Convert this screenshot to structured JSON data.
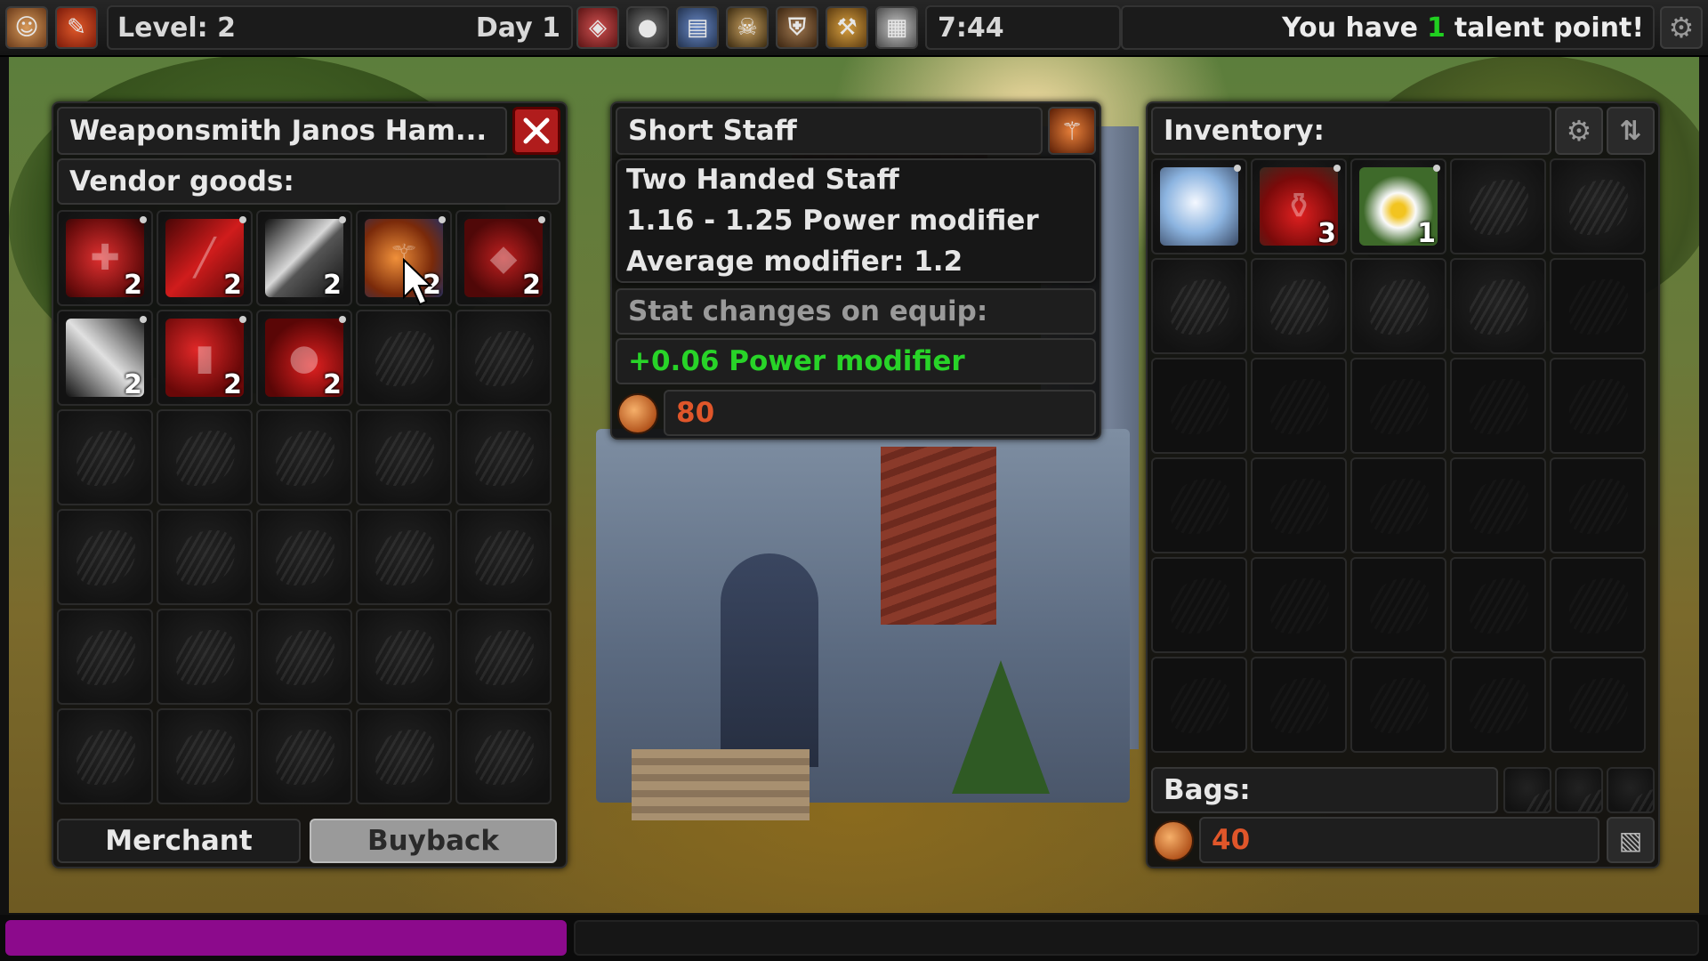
{
  "hud": {
    "level_label": "Level: 2",
    "day_label": "Day 1",
    "time": "7:44",
    "talent_prefix": "You have",
    "talent_points": "1",
    "talent_suffix": "talent point!",
    "xp_progress": 0.335,
    "menu_icons": [
      "portrait-icon",
      "quill-icon",
      "backpack-icon",
      "ore-icon",
      "spellbook-icon",
      "skull-flag-icon",
      "armor-icon",
      "crafting-icon",
      "scroll-icon"
    ],
    "settings_icon": "gear-icon"
  },
  "vendor": {
    "title": "Weaponsmith Janos Ham...",
    "section_label": "Vendor goods:",
    "items": [
      {
        "icon": "red-mace-icon",
        "count": "2"
      },
      {
        "icon": "red-staff-icon",
        "count": "2"
      },
      {
        "icon": "steel-sword-icon",
        "count": "2"
      },
      {
        "icon": "short-staff-icon",
        "count": "2"
      },
      {
        "icon": "red-axe-icon",
        "count": "2"
      },
      {
        "icon": "dagger-icon",
        "count": "2"
      },
      {
        "icon": "red-hammer-icon",
        "count": "2"
      },
      {
        "icon": "red-club-icon",
        "count": "2"
      }
    ],
    "tab_merchant": "Merchant",
    "tab_buyback": "Buyback"
  },
  "tooltip": {
    "item_name": "Short Staff",
    "item_type": "Two Handed Staff",
    "modifier_range": "1.16 - 1.25 Power modifier",
    "average_modifier": "Average modifier: 1.2",
    "stat_changes_label": "Stat changes on equip:",
    "stat_change": "+0.06 Power modifier",
    "price": "80",
    "colors": {
      "stat_positive": "#28d428",
      "price": "#e0562a"
    }
  },
  "inventory": {
    "title": "Inventory:",
    "items": [
      {
        "icon": "silver-orb-icon",
        "count": ""
      },
      {
        "icon": "health-potion-icon",
        "count": "3"
      },
      {
        "icon": "daisy-flower-icon",
        "count": "1"
      }
    ],
    "bags_label": "Bags:",
    "gold": "40"
  }
}
